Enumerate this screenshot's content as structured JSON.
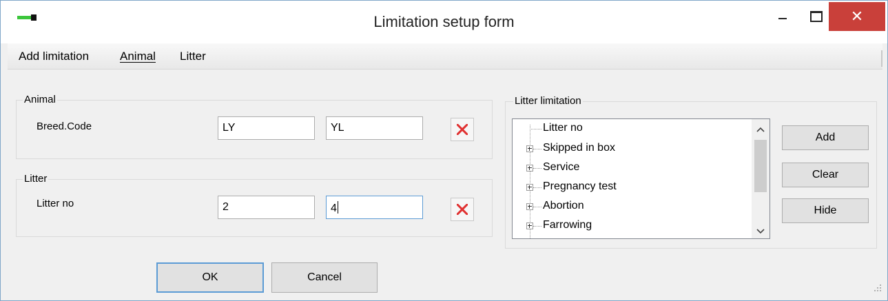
{
  "window": {
    "title": "Limitation setup form",
    "close_glyph": "✕"
  },
  "menu": {
    "items": [
      "Add limitation",
      "Animal",
      "Litter"
    ]
  },
  "animal_group": {
    "legend": "Animal",
    "row_label": "Breed.Code",
    "value_from": "LY",
    "value_to": "YL"
  },
  "litter_group": {
    "legend": "Litter",
    "row_label": "Litter no",
    "value_from": "2",
    "value_to": "4"
  },
  "litter_limitation": {
    "legend": "Litter limitation",
    "tree_items": [
      {
        "label": "Litter no",
        "expandable": false
      },
      {
        "label": "Skipped in box",
        "expandable": true
      },
      {
        "label": "Service",
        "expandable": true
      },
      {
        "label": "Pregnancy test",
        "expandable": true
      },
      {
        "label": "Abortion",
        "expandable": true
      },
      {
        "label": "Farrowing",
        "expandable": true
      }
    ],
    "buttons": {
      "add": "Add",
      "clear": "Clear",
      "hide": "Hide"
    }
  },
  "footer": {
    "ok": "OK",
    "cancel": "Cancel"
  },
  "icons": {
    "delete_color": "#e03030",
    "close_bg": "#c9403a",
    "focus_border": "#5b9bd5"
  }
}
